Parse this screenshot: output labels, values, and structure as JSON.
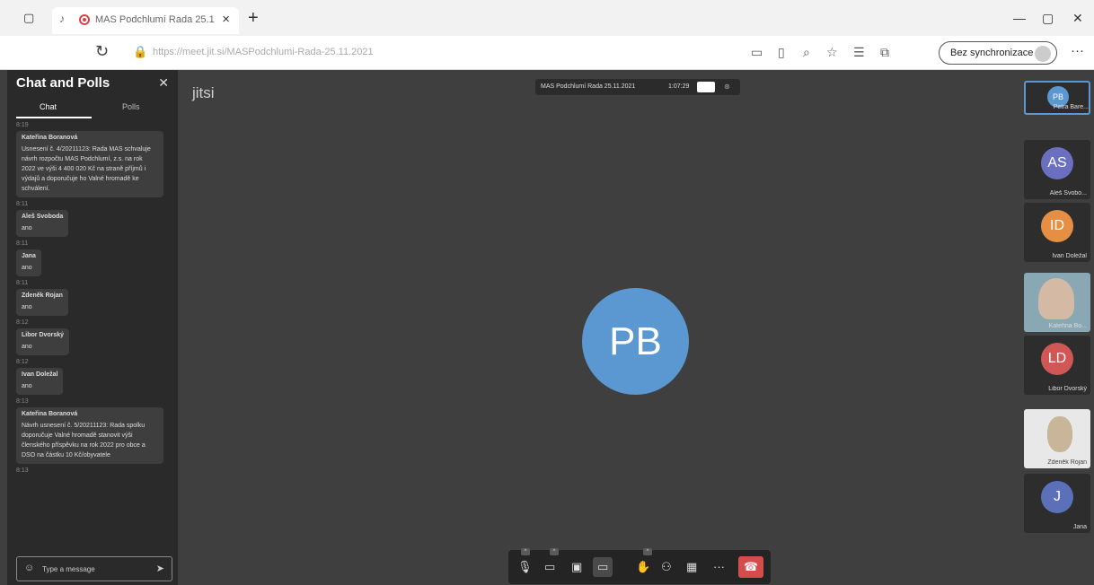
{
  "browser": {
    "tab_title": "MAS Podchlumí Rada 25.1",
    "url": "https://meet.jit.si/MASPodchlumi-Rada-25.11.2021",
    "sync_label": "Bez synchronizace",
    "icons": [
      "tab-actions-icon",
      "speaker-icon",
      "recording-icon",
      "close-icon",
      "new-tab-icon",
      "minimize-icon",
      "maximize-icon",
      "window-close-icon",
      "reload-icon",
      "lock-icon",
      "camera-icon",
      "read-mode-icon",
      "zoom-icon",
      "favorite-icon",
      "favorites-list-icon",
      "collections-icon",
      "more-icon"
    ]
  },
  "chat": {
    "title": "Chat and Polls",
    "tabs": [
      "Chat",
      "Polls"
    ],
    "messages": [
      {
        "ts": "8:19",
        "who": "Kateřina Boranová",
        "text": "Usnesení č. 4/20211123: Rada MAS schvaluje návrh rozpočtu MAS Podchlumí, z.s. na rok 2022 ve výši 4 400 020 Kč na straně příjmů i výdajů a doporučuje ho Valné hromadě ke schválení."
      },
      {
        "ts": "8:11",
        "who": "Aleš Svoboda",
        "text": "ano"
      },
      {
        "ts": "8:11",
        "who": "Jana",
        "text": "ano"
      },
      {
        "ts": "8:11",
        "who": "Zdeněk Rojan",
        "text": "ano"
      },
      {
        "ts": "8:12",
        "who": "Libor Dvorský",
        "text": "ano"
      },
      {
        "ts": "8:12",
        "who": "Ivan Doležal",
        "text": "ano"
      },
      {
        "ts": "8:13",
        "who": "Kateřina Boranová",
        "text": "Návrh usnesení č. 5/20211123: Rada spolku doporučuje Valné hromadě stanovit výši členského příspěvku na rok 2022 pro obce a DSO na částku 10 Kč/obyvatele"
      },
      {
        "ts": "8:13",
        "who": "",
        "text": ""
      }
    ],
    "input_placeholder": "Type a message"
  },
  "stage": {
    "logo": "jitsi",
    "subject": "MAS Podchlumí Rada 25.11.2021",
    "timer": "1:07:29",
    "main_avatar": {
      "initials": "PB",
      "color": "#5b97d0"
    }
  },
  "toolbar": {
    "buttons": [
      "microphone-muted-icon",
      "camera-muted-icon",
      "share-screen-icon",
      "chat-icon",
      "raise-hand-icon",
      "invite-icon",
      "tile-view-icon",
      "more-actions-icon",
      "hangup-icon"
    ]
  },
  "filmstrip": [
    {
      "name": "Petra Bare...",
      "initials": "PB",
      "color": "#5b97d0",
      "kind": "avatar"
    },
    {
      "name": "Aleš Svobo...",
      "initials": "AS",
      "color": "#6a6fc0",
      "kind": "avatar"
    },
    {
      "name": "Ivan Doležal",
      "initials": "ID",
      "color": "#e58f44",
      "kind": "avatar"
    },
    {
      "name": "Kateřina Bo...",
      "initials": "",
      "color": "#8aa8b4",
      "kind": "video"
    },
    {
      "name": "Libor Dvorský",
      "initials": "LD",
      "color": "#d15656",
      "kind": "avatar"
    },
    {
      "name": "Zdeněk Rojan",
      "initials": "",
      "color": "#e8e8e8",
      "kind": "video2"
    },
    {
      "name": "Jana",
      "initials": "J",
      "color": "#5b70b8",
      "kind": "avatar"
    }
  ]
}
